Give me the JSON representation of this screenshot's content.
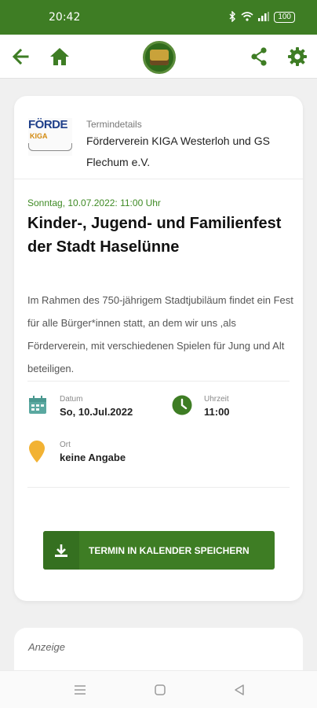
{
  "status_bar": {
    "time": "20:42",
    "battery": "100"
  },
  "app_bar": {
    "icons": [
      "back-arrow-icon",
      "home-icon",
      "club-logo",
      "share-icon",
      "settings-icon"
    ]
  },
  "colors": {
    "primary": "#3e7d24",
    "date_green": "#3e8a24",
    "marker_yellow": "#f2b233",
    "calendar_teal": "#5aa8a0"
  },
  "organizer": {
    "logo_text": "FÖRDE",
    "logo_sub": "KIGA",
    "label": "Termindetails",
    "name": "Förderverein KIGA Westerloh und GS Flechum e.V."
  },
  "event": {
    "date": "Sonntag, 10.07.2022: 11:00 Uhr",
    "title": "Kinder-, Jugend- und Familienfest der Stadt Haselünne",
    "description": "Im Rahmen des 750-jährigem Stadtjubiläum findet ein Fest für alle Bürger*innen statt, an dem wir uns ,als Förderverein, mit verschiedenen Spielen für Jung und Alt beteiligen."
  },
  "details": {
    "date_label": "Datum",
    "date_value": "So, 10.Jul.2022",
    "time_label": "Uhrzeit",
    "time_value": "11:00",
    "place_label": "Ort",
    "place_value": "keine Angabe"
  },
  "actions": {
    "save_label": "TERMIN IN KALENDER SPEICHERN"
  },
  "ad": {
    "label": "Anzeige"
  },
  "nav": {
    "icons": [
      "recents-icon",
      "home-nav-icon",
      "back-nav-icon"
    ]
  }
}
